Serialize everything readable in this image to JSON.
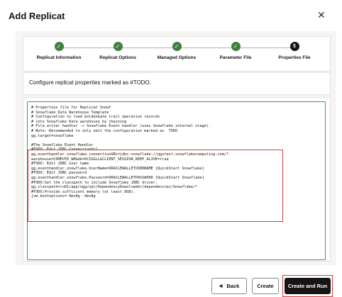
{
  "dialog": {
    "title": "Add Replicat",
    "close_icon": "close-icon"
  },
  "steps": [
    {
      "label": "Replicat Information",
      "state": "done"
    },
    {
      "label": "Replicat Options",
      "state": "done"
    },
    {
      "label": "Managed Options",
      "state": "done"
    },
    {
      "label": "Parameter File",
      "state": "done"
    },
    {
      "label": "Properties File",
      "state": "current",
      "number": "5"
    }
  ],
  "instruction": "Configure replicat properties marked as #TODO.",
  "properties_text": "# Properties file for Replicat Snowf\n# Snowflake Data Warehouse Template\n# Configuration to load GoldenGate trail operation records\n# into Snowflake Data warehouse by chaining\n# File writer handler -> Snowflake Event handler (uses Snowflake internal stage).\n# Note: Recommended to only edit the configuration marked as  TODO\ngg.target=snowflake\n\n#The Snowflake Event Handler\n#TODO: Edit JDBC ConnectionUrl\ngg.eventhandler.snowflake.connectionURL=jdbc:snowflake://ggstest.snowflakecomputing.com/?\nwarehouse=COMPUTE_WH&db=OCIGGLL&CLIENT_SESSION_KEEP_ALIVE=true\n#TODO: Edit JDBC user name\ngg.eventhandler.snowflake.UserName=ORACLEWALLETUSERNAME [QuickStart Snowflake]\n#TODO: Edit JDBC password\ngg.eventhandler.snowflake.Password=ORACLEWALLETPASSWORD [QuickStart Snowflake]\n#TODO:Set the classpath to include Snowflake JDBC driver.\ngg.classpath=/u01/app/ogg/opt/DependencyDownloader/dependencies/Snowflake/*\n#TODO:Provide sufficient memory (at least 8GB).\njvm.bootoptions=-Xmx8g -Xms8g",
  "footer": {
    "back_label": "Back",
    "create_label": "Create",
    "create_run_label": "Create and Run"
  },
  "colors": {
    "done": "#3f7f3f",
    "current": "#161513",
    "editor_border": "#3a8ca8",
    "highlight": "#d23b3b"
  }
}
